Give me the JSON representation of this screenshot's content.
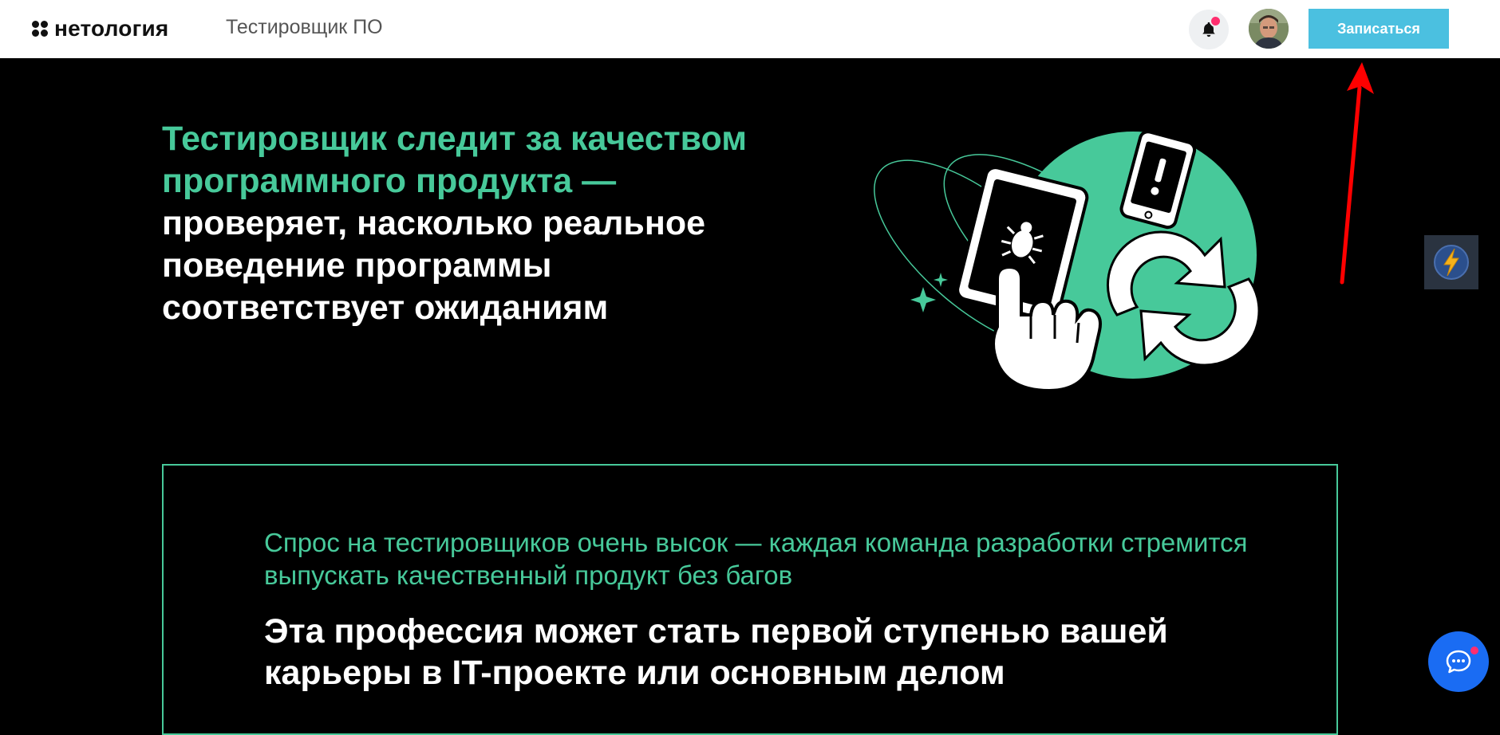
{
  "header": {
    "logo_text": "нетология",
    "course_title": "Тестировщик ПО",
    "signup_label": "Записаться",
    "notification_icon": "bell-icon",
    "avatar_icon": "user-avatar"
  },
  "hero": {
    "heading_accent": "Тестировщик следит за качеством программного продукта — ",
    "heading_rest": "проверяет, насколько реальное поведение программы соответствует ожиданиям"
  },
  "info": {
    "lead": "Спрос на тестировщиков очень высок — каждая команда разработки стремится выпускать качественный продукт без багов",
    "main": "Эта профессия может стать первой ступенью вашей карьеры в IT-проекте или основным делом"
  },
  "colors": {
    "accent": "#47c99a",
    "button": "#4bc0e0",
    "chat": "#1a6cf3",
    "badge": "#ff2e6f"
  }
}
